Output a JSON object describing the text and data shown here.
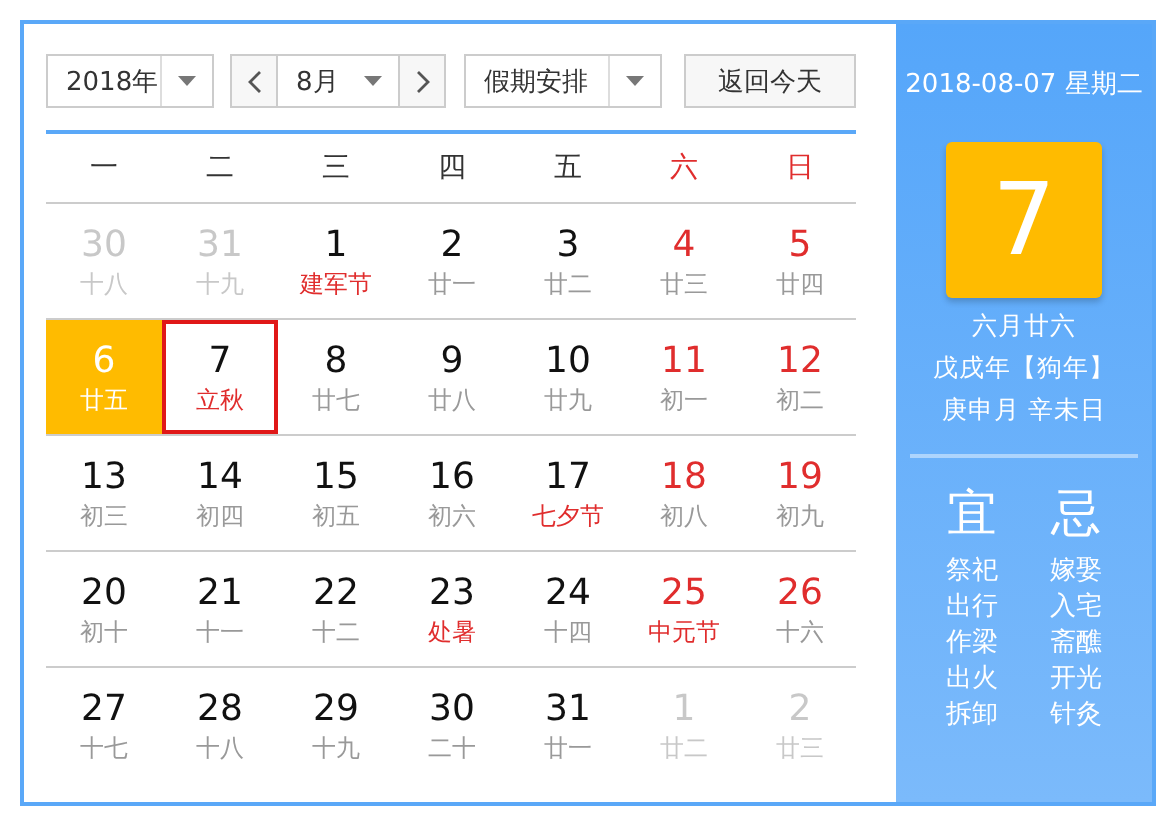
{
  "toolbar": {
    "year": "2018年",
    "month": "8月",
    "holiday": "假期安排",
    "today_button": "返回今天"
  },
  "weekdays": [
    {
      "label": "一",
      "weekend": false
    },
    {
      "label": "二",
      "weekend": false
    },
    {
      "label": "三",
      "weekend": false
    },
    {
      "label": "四",
      "weekend": false
    },
    {
      "label": "五",
      "weekend": false
    },
    {
      "label": "六",
      "weekend": true
    },
    {
      "label": "日",
      "weekend": true
    }
  ],
  "weeks": [
    [
      {
        "day": "30",
        "lunar": "十八",
        "other_month": true,
        "weekend": false,
        "festival": false,
        "today": false,
        "selected": false
      },
      {
        "day": "31",
        "lunar": "十九",
        "other_month": true,
        "weekend": false,
        "festival": false,
        "today": false,
        "selected": false
      },
      {
        "day": "1",
        "lunar": "建军节",
        "other_month": false,
        "weekend": false,
        "festival": true,
        "today": false,
        "selected": false
      },
      {
        "day": "2",
        "lunar": "廿一",
        "other_month": false,
        "weekend": false,
        "festival": false,
        "today": false,
        "selected": false
      },
      {
        "day": "3",
        "lunar": "廿二",
        "other_month": false,
        "weekend": false,
        "festival": false,
        "today": false,
        "selected": false
      },
      {
        "day": "4",
        "lunar": "廿三",
        "other_month": false,
        "weekend": true,
        "festival": false,
        "today": false,
        "selected": false
      },
      {
        "day": "5",
        "lunar": "廿四",
        "other_month": false,
        "weekend": true,
        "festival": false,
        "today": false,
        "selected": false
      }
    ],
    [
      {
        "day": "6",
        "lunar": "廿五",
        "other_month": false,
        "weekend": false,
        "festival": false,
        "today": true,
        "selected": false
      },
      {
        "day": "7",
        "lunar": "立秋",
        "other_month": false,
        "weekend": false,
        "festival": true,
        "today": false,
        "selected": true
      },
      {
        "day": "8",
        "lunar": "廿七",
        "other_month": false,
        "weekend": false,
        "festival": false,
        "today": false,
        "selected": false
      },
      {
        "day": "9",
        "lunar": "廿八",
        "other_month": false,
        "weekend": false,
        "festival": false,
        "today": false,
        "selected": false
      },
      {
        "day": "10",
        "lunar": "廿九",
        "other_month": false,
        "weekend": false,
        "festival": false,
        "today": false,
        "selected": false
      },
      {
        "day": "11",
        "lunar": "初一",
        "other_month": false,
        "weekend": true,
        "festival": false,
        "today": false,
        "selected": false
      },
      {
        "day": "12",
        "lunar": "初二",
        "other_month": false,
        "weekend": true,
        "festival": false,
        "today": false,
        "selected": false
      }
    ],
    [
      {
        "day": "13",
        "lunar": "初三",
        "other_month": false,
        "weekend": false,
        "festival": false,
        "today": false,
        "selected": false
      },
      {
        "day": "14",
        "lunar": "初四",
        "other_month": false,
        "weekend": false,
        "festival": false,
        "today": false,
        "selected": false
      },
      {
        "day": "15",
        "lunar": "初五",
        "other_month": false,
        "weekend": false,
        "festival": false,
        "today": false,
        "selected": false
      },
      {
        "day": "16",
        "lunar": "初六",
        "other_month": false,
        "weekend": false,
        "festival": false,
        "today": false,
        "selected": false
      },
      {
        "day": "17",
        "lunar": "七夕节",
        "other_month": false,
        "weekend": false,
        "festival": true,
        "today": false,
        "selected": false
      },
      {
        "day": "18",
        "lunar": "初八",
        "other_month": false,
        "weekend": true,
        "festival": false,
        "today": false,
        "selected": false
      },
      {
        "day": "19",
        "lunar": "初九",
        "other_month": false,
        "weekend": true,
        "festival": false,
        "today": false,
        "selected": false
      }
    ],
    [
      {
        "day": "20",
        "lunar": "初十",
        "other_month": false,
        "weekend": false,
        "festival": false,
        "today": false,
        "selected": false
      },
      {
        "day": "21",
        "lunar": "十一",
        "other_month": false,
        "weekend": false,
        "festival": false,
        "today": false,
        "selected": false
      },
      {
        "day": "22",
        "lunar": "十二",
        "other_month": false,
        "weekend": false,
        "festival": false,
        "today": false,
        "selected": false
      },
      {
        "day": "23",
        "lunar": "处暑",
        "other_month": false,
        "weekend": false,
        "festival": true,
        "today": false,
        "selected": false
      },
      {
        "day": "24",
        "lunar": "十四",
        "other_month": false,
        "weekend": false,
        "festival": false,
        "today": false,
        "selected": false
      },
      {
        "day": "25",
        "lunar": "中元节",
        "other_month": false,
        "weekend": true,
        "festival": true,
        "today": false,
        "selected": false
      },
      {
        "day": "26",
        "lunar": "十六",
        "other_month": false,
        "weekend": true,
        "festival": false,
        "today": false,
        "selected": false
      }
    ],
    [
      {
        "day": "27",
        "lunar": "十七",
        "other_month": false,
        "weekend": false,
        "festival": false,
        "today": false,
        "selected": false
      },
      {
        "day": "28",
        "lunar": "十八",
        "other_month": false,
        "weekend": false,
        "festival": false,
        "today": false,
        "selected": false
      },
      {
        "day": "29",
        "lunar": "十九",
        "other_month": false,
        "weekend": false,
        "festival": false,
        "today": false,
        "selected": false
      },
      {
        "day": "30",
        "lunar": "二十",
        "other_month": false,
        "weekend": false,
        "festival": false,
        "today": false,
        "selected": false
      },
      {
        "day": "31",
        "lunar": "廿一",
        "other_month": false,
        "weekend": false,
        "festival": false,
        "today": false,
        "selected": false
      },
      {
        "day": "1",
        "lunar": "廿二",
        "other_month": true,
        "weekend": true,
        "festival": false,
        "today": false,
        "selected": false
      },
      {
        "day": "2",
        "lunar": "廿三",
        "other_month": true,
        "weekend": true,
        "festival": false,
        "today": false,
        "selected": false
      }
    ]
  ],
  "side_panel": {
    "date": "2018-08-07 星期二",
    "big_day": "7",
    "lunar_lines": [
      "六月廿六",
      "戊戌年【狗年】",
      "庚申月 辛未日"
    ],
    "suitable": {
      "title": "宜",
      "items": [
        "祭祀",
        "出行",
        "作梁",
        "出火",
        "拆卸"
      ]
    },
    "avoid": {
      "title": "忌",
      "items": [
        "嫁娶",
        "入宅",
        "斋醮",
        "开光",
        "针灸"
      ]
    }
  }
}
